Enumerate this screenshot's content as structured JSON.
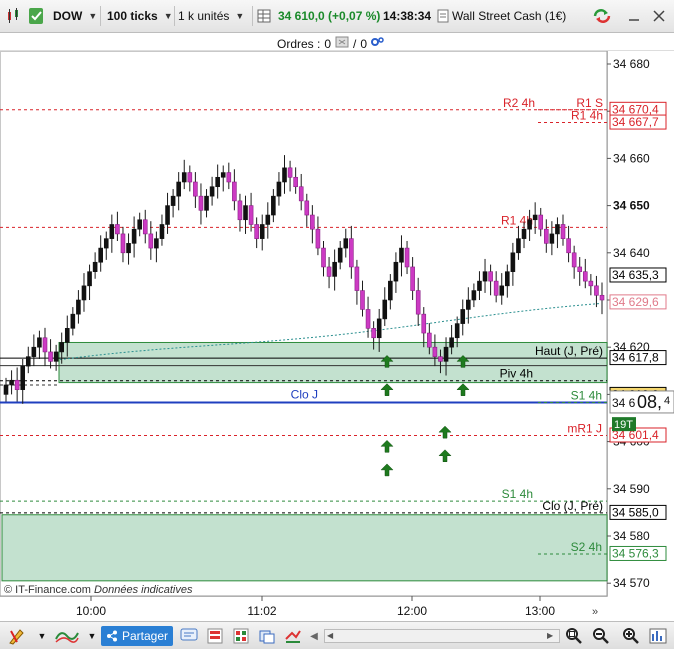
{
  "toolbar": {
    "instrument": "DOW",
    "ticks": "100 ticks",
    "units": "1 k unités",
    "last_price": "34 610,0 (+0,07 %)",
    "time": "14:38:34",
    "market_name": "Wall Street Cash (1€)"
  },
  "orders": {
    "label": "Ordres :",
    "count1": "0",
    "count2": "0",
    "separator": "/"
  },
  "chart": {
    "watermark": "© IT-Finance.com",
    "watermark_italic": "Données indicatives",
    "y_ticks": [
      "34 680",
      "34 670",
      "34 660",
      "34 650",
      "34 640",
      "34 630",
      "34 620",
      "34 610",
      "34 600",
      "34 590",
      "34 580",
      "34 570"
    ],
    "x_ticks": [
      "10:00",
      "11:02",
      "12:00",
      "13:00"
    ],
    "levels": [
      {
        "name": "R2 4h",
        "value": 34670.4,
        "color": "#d9232a",
        "dash": "3,3",
        "label_side": "right-inner"
      },
      {
        "name": "R1 S",
        "value": 34670.4,
        "color": "#d9232a",
        "dash": "3,3"
      },
      {
        "name": "R1 4h",
        "value": 34667.7,
        "color": "#d9232a",
        "dash": "3,3"
      },
      {
        "name": "R1 4h",
        "value": 34645.5,
        "color": "#d9232a",
        "dash": "3,3"
      },
      {
        "name": "Haut (J, Pré)",
        "value": 34617.8,
        "color": "#000000",
        "dash": ""
      },
      {
        "name": "Piv 4h",
        "value": 34613.0,
        "color": "#000000",
        "dash": "3,3"
      },
      {
        "name": "Clo J",
        "value": 34608.4,
        "color": "#1f3fbf",
        "dash": ""
      },
      {
        "name": "S1 4h",
        "value": 34608.4,
        "color": "#2e8b3c",
        "dash": "3,3"
      },
      {
        "name": "mR1 J",
        "value": 34601.4,
        "color": "#d9232a",
        "dash": "3,3"
      },
      {
        "name": "S1 4h",
        "value": 34587.5,
        "color": "#2e8b3c",
        "dash": "3,3"
      },
      {
        "name": "Clo (J, Pré)",
        "value": 34585.0,
        "color": "#000000",
        "dash": "3,3"
      },
      {
        "name": "S2 4h",
        "value": 34576.3,
        "color": "#2e8b3c",
        "dash": "3,3"
      }
    ],
    "price_labels": [
      {
        "text": "34 670,4",
        "value": 34670.4,
        "color": "#d9232a"
      },
      {
        "text": "34 667,7",
        "value": 34667.7,
        "color": "#d9232a"
      },
      {
        "text": "34 635,3",
        "value": 34635.3,
        "color": "#000000"
      },
      {
        "text": "34 629,6",
        "value": 34629.6,
        "color": "#e07a8a"
      },
      {
        "text": "34 617,8",
        "value": 34617.8,
        "color": "#000000"
      },
      {
        "text": "34 610,0",
        "value": 34610.0,
        "color": "#000000",
        "bg": "#f5d76e"
      },
      {
        "text": "34 601,4",
        "value": 34601.4,
        "color": "#d9232a"
      },
      {
        "text": "34 585,0",
        "value": 34585.0,
        "color": "#000000"
      },
      {
        "text": "34 576,3",
        "value": 34576.3,
        "color": "#2e8b3c"
      }
    ],
    "current_price_big": "08,",
    "current_price_big_small": "4",
    "current_price_prefix": "34 6",
    "countdown_label": "19T",
    "zones": [
      {
        "name": "pivot-zone",
        "from": 34612.5,
        "to": 34621.0
      },
      {
        "name": "s-zone",
        "from": 34570.5,
        "to": 34584.5
      }
    ]
  },
  "bottom": {
    "share_label": "Partager"
  }
}
